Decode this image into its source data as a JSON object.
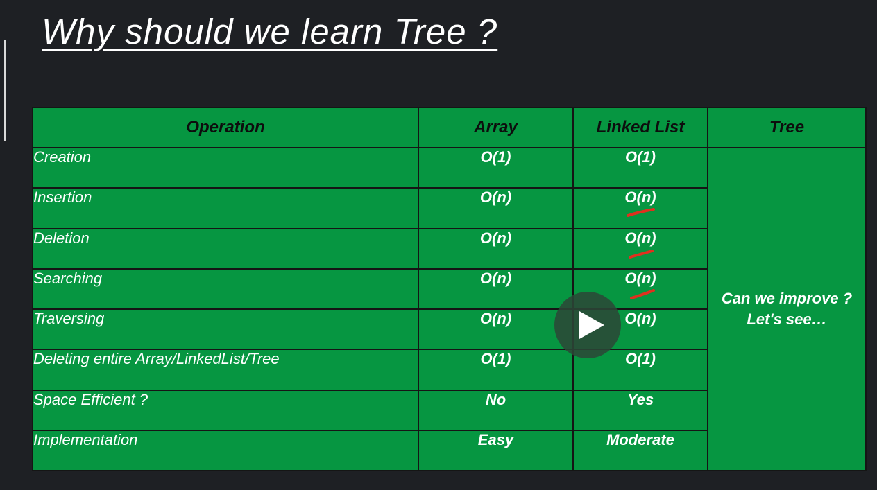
{
  "title": "Why should we learn Tree ?",
  "table": {
    "headers": [
      "Operation",
      "Array",
      "Linked List",
      "Tree"
    ],
    "rows": [
      {
        "operation": "Creation",
        "array": "O(1)",
        "linked_list": "O(1)"
      },
      {
        "operation": "Insertion",
        "array": "O(n)",
        "linked_list": "O(n)"
      },
      {
        "operation": "Deletion",
        "array": "O(n)",
        "linked_list": "O(n)"
      },
      {
        "operation": "Searching",
        "array": "O(n)",
        "linked_list": "O(n)"
      },
      {
        "operation": "Traversing",
        "array": "O(n)",
        "linked_list": "O(n)"
      },
      {
        "operation": "Deleting entire Array/LinkedList/Tree",
        "array": "O(1)",
        "linked_list": "O(1)"
      },
      {
        "operation": "Space Efficient  ?",
        "array": "No",
        "linked_list": "Yes"
      },
      {
        "operation": "Implementation",
        "array": "Easy",
        "linked_list": "Moderate"
      }
    ],
    "tree_note_line1": "Can we improve ?",
    "tree_note_line2": "Let's see…"
  },
  "colors": {
    "background": "#1e2024",
    "table_green": "#069641",
    "yes": "#f2f23a",
    "moderate": "#e0301e",
    "annotation_tick": "#e0301e"
  },
  "icons": {
    "play": "play-icon",
    "tick": "red-tick-mark"
  }
}
